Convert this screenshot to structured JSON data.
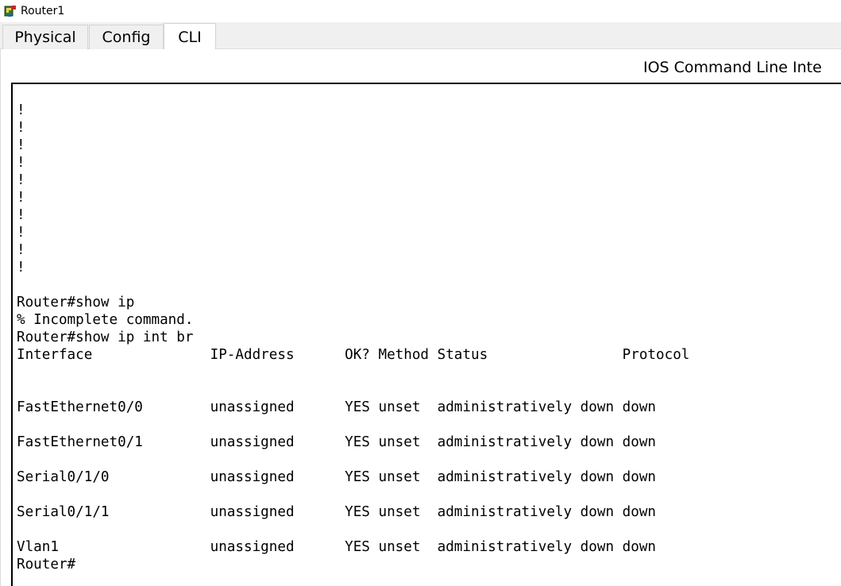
{
  "window": {
    "title": "Router1",
    "icon": "router-icon"
  },
  "tabs": [
    {
      "label": "Physical",
      "active": false
    },
    {
      "label": "Config",
      "active": false
    },
    {
      "label": "CLI",
      "active": true
    }
  ],
  "panel": {
    "heading": "IOS Command Line Inte"
  },
  "terminal": {
    "lines": [
      "",
      "!",
      "!",
      "!",
      "!",
      "!",
      "!",
      "!",
      "!",
      "!",
      "!",
      "",
      "Router#show ip",
      "% Incomplete command.",
      "Router#show ip int br",
      "Interface              IP-Address      OK? Method Status                Protocol",
      "",
      "",
      "FastEthernet0/0        unassigned      YES unset  administratively down down",
      "",
      "FastEthernet0/1        unassigned      YES unset  administratively down down",
      "",
      "Serial0/1/0            unassigned      YES unset  administratively down down",
      "",
      "Serial0/1/1            unassigned      YES unset  administratively down down",
      "",
      "Vlan1                  unassigned      YES unset  administratively down down",
      "Router#"
    ]
  },
  "colors": {
    "tab_bar_bg": "#f0f0f0",
    "terminal_border": "#000000",
    "terminal_text": "#000000"
  }
}
